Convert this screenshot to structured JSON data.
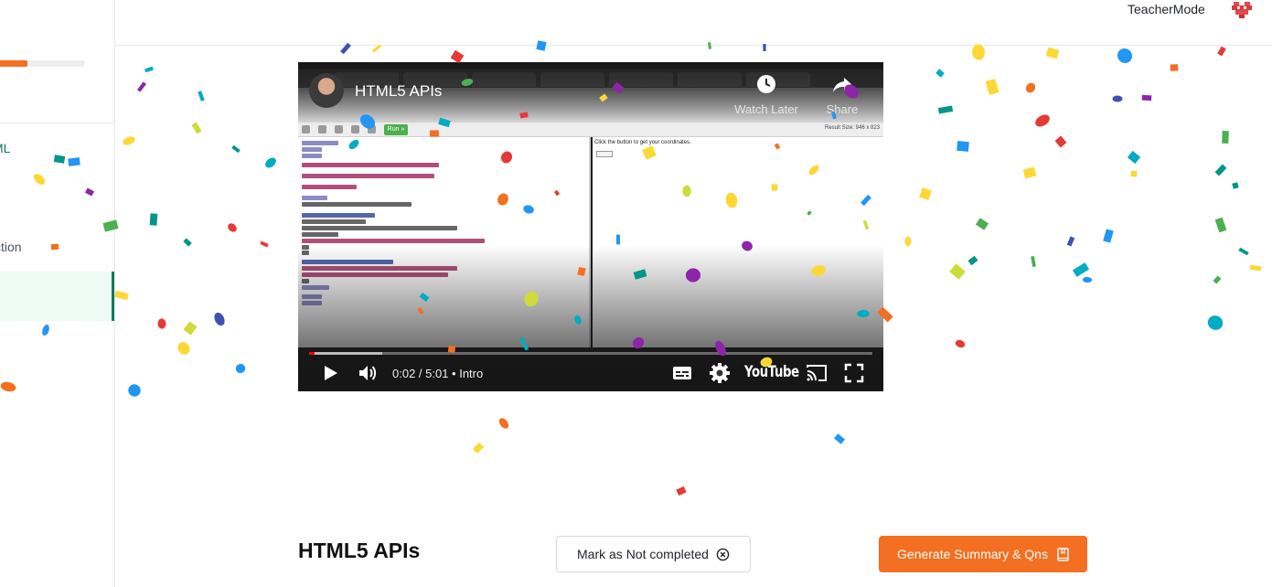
{
  "topbar": {
    "teacher_mode_label": "TeacherMode",
    "avatar_icon": "pixel-heart-avatar-icon"
  },
  "sidebar": {
    "progress_fraction": 0.32,
    "items": [
      {
        "label": "ML",
        "visible": "ML"
      },
      {
        "label": "ction",
        "visible": "ction"
      }
    ]
  },
  "video": {
    "title": "HTML5 APIs",
    "watch_later_label": "Watch Later",
    "share_label": "Share",
    "current_time": "0:02",
    "duration": "5:01",
    "chapter": "Intro",
    "time_display": "0:02 / 5:01  •  Intro",
    "brand": "YouTube",
    "played_fraction": 0.0066,
    "editor_run_label": "Run »",
    "result_size_label": "Result Size: 946 x 823",
    "result_text": "Click the button to get your coordinates."
  },
  "lesson": {
    "title": "HTML5 APIs",
    "mark_not_completed_label": "Mark as Not completed",
    "generate_label": "Generate Summary & Qns"
  },
  "colors": {
    "accent": "#f36f21",
    "active_green": "#0f7a5f",
    "confetti": [
      "#f36f21",
      "#2196f3",
      "#8e24aa",
      "#4caf50",
      "#fdd835",
      "#00acc1",
      "#e53935",
      "#3f51b5",
      "#009688",
      "#cddc39"
    ]
  }
}
